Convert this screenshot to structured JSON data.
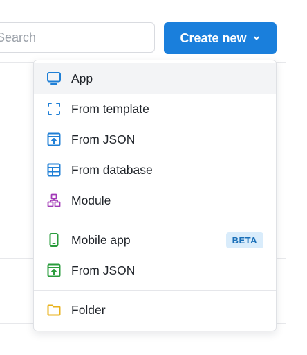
{
  "search": {
    "placeholder": "Search",
    "value": ""
  },
  "create_button": {
    "label": "Create new",
    "icon": "chevron-down-icon",
    "color": "#1a7fdc"
  },
  "menu": {
    "groups": [
      {
        "items": [
          {
            "label": "App",
            "icon": "monitor-icon",
            "icon_color": "#1f7fd6",
            "active": true
          },
          {
            "label": "From template",
            "icon": "template-frame-icon",
            "icon_color": "#1f7fd6"
          },
          {
            "label": "From JSON",
            "icon": "import-json-icon",
            "icon_color": "#1f7fd6"
          },
          {
            "label": "From database",
            "icon": "database-table-icon",
            "icon_color": "#1f7fd6"
          },
          {
            "label": "Module",
            "icon": "module-icon",
            "icon_color": "#a23bb8"
          }
        ]
      },
      {
        "items": [
          {
            "label": "Mobile app",
            "icon": "mobile-phone-icon",
            "icon_color": "#2a9c3c",
            "badge": "BETA"
          },
          {
            "label": "From JSON",
            "icon": "import-json-icon",
            "icon_color": "#2a9c3c"
          }
        ]
      },
      {
        "items": [
          {
            "label": "Folder",
            "icon": "folder-icon",
            "icon_color": "#e9b21b"
          }
        ]
      }
    ]
  }
}
